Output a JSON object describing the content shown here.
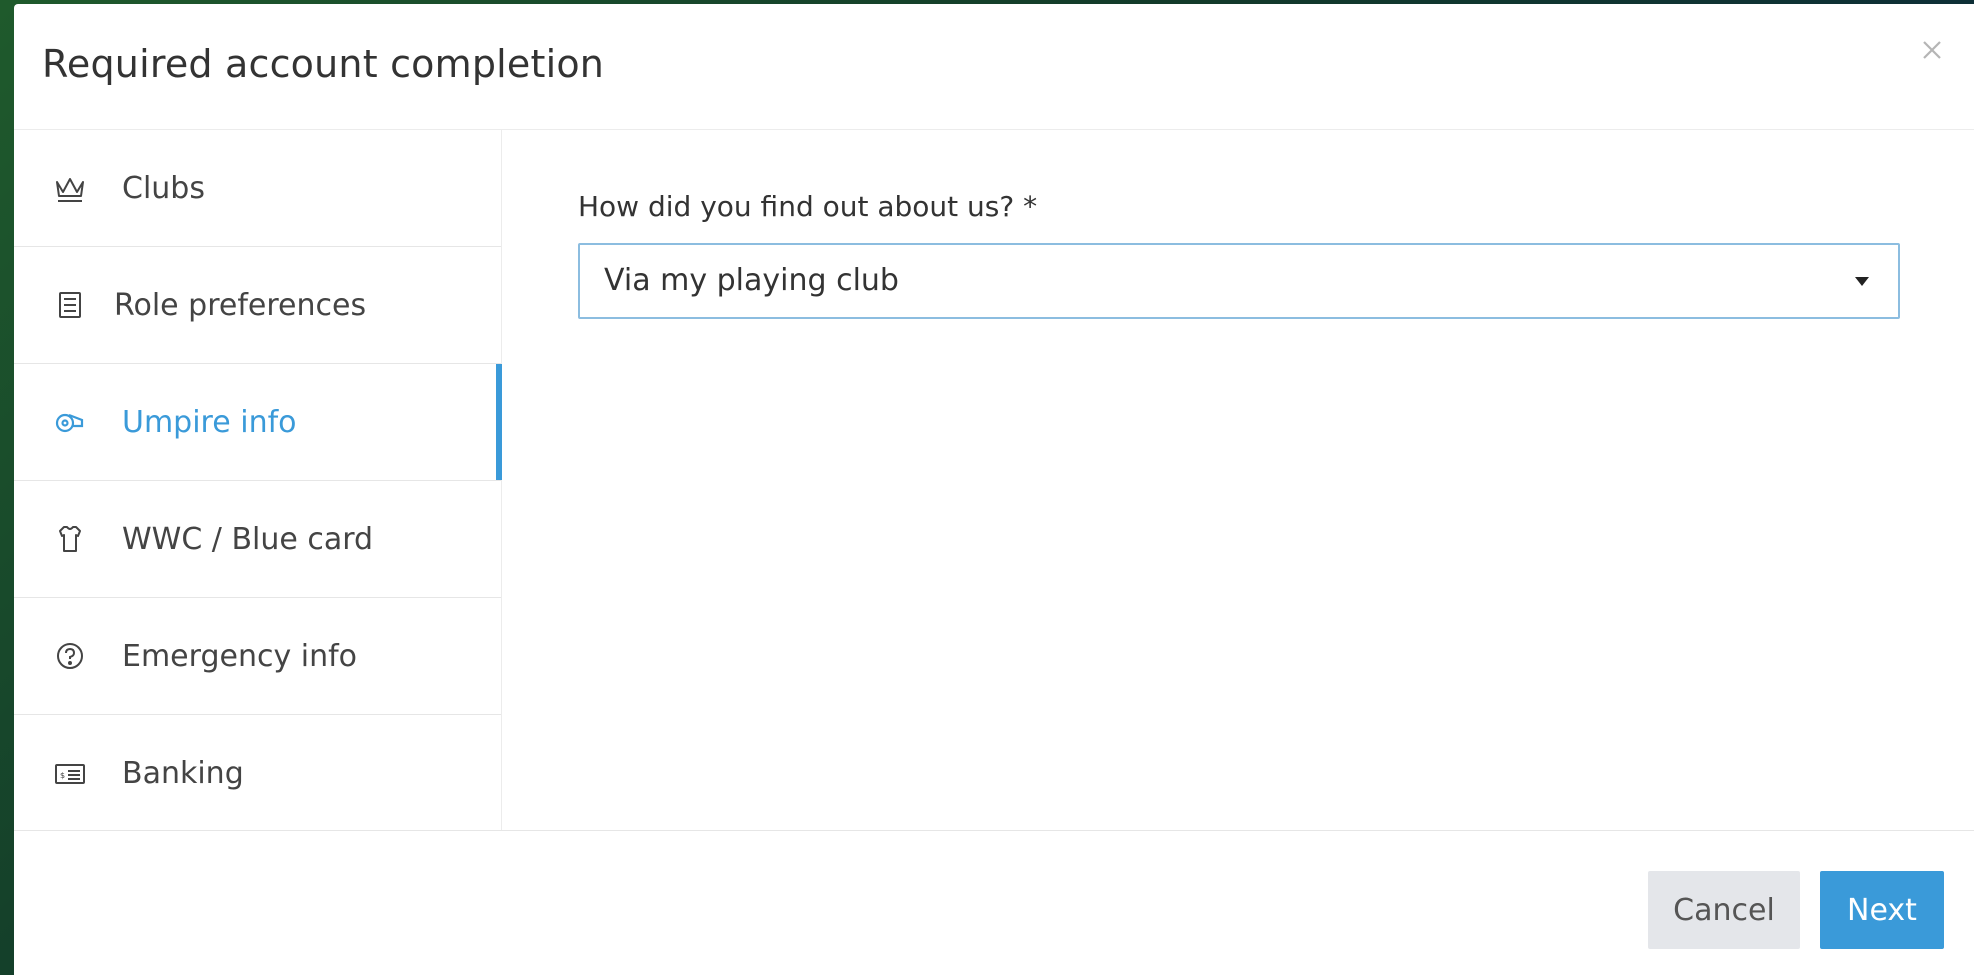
{
  "dialog": {
    "title": "Required account completion"
  },
  "sidebar": {
    "items": [
      {
        "label": "Clubs",
        "icon": "crown-icon",
        "active": false
      },
      {
        "label": "Role preferences",
        "icon": "list-icon",
        "active": false
      },
      {
        "label": "Umpire info",
        "icon": "whistle-icon",
        "active": true
      },
      {
        "label": "WWC / Blue card",
        "icon": "shirt-icon",
        "active": false
      },
      {
        "label": "Emergency info",
        "icon": "question-circle-icon",
        "active": false
      },
      {
        "label": "Banking",
        "icon": "money-card-icon",
        "active": false
      }
    ]
  },
  "form": {
    "field_label": "How did you find out about us? *",
    "selected_value": "Via my playing club"
  },
  "footer": {
    "cancel_label": "Cancel",
    "next_label": "Next"
  },
  "colors": {
    "accent": "#3a9ad9",
    "cancel_bg": "#e4e6ea"
  }
}
